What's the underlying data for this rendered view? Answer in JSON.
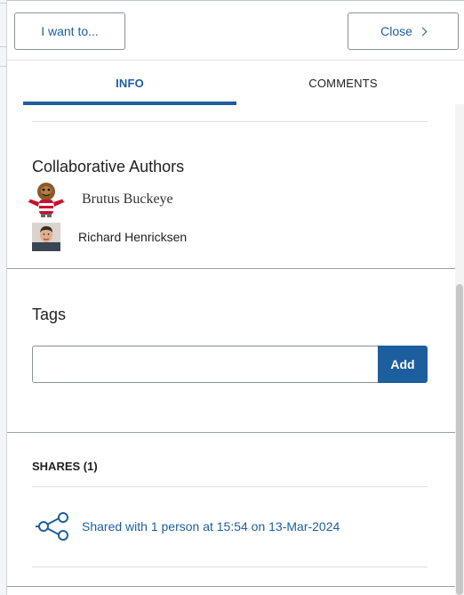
{
  "toolbar": {
    "i_want_label": "I want to...",
    "close_label": "Close"
  },
  "tabs": [
    {
      "label": "INFO",
      "active": true
    },
    {
      "label": "COMMENTS",
      "active": false
    }
  ],
  "authors": {
    "title": "Collaborative Authors",
    "items": [
      {
        "name": "Brutus Buckeye",
        "avatar": "mascot-avatar"
      },
      {
        "name": "Richard Henricksen",
        "avatar": "user-photo-avatar"
      }
    ]
  },
  "tags": {
    "title": "Tags",
    "input_value": "",
    "add_label": "Add"
  },
  "shares": {
    "title": "SHARES (1)",
    "items": [
      {
        "text": "Shared with 1 person at 15:54 on 13-Mar-2024",
        "icon": "share-icon"
      }
    ]
  },
  "colors": {
    "accent": "#1d5f9e",
    "divider": "#dcdfe2",
    "section_divider": "#9aa0a5"
  }
}
